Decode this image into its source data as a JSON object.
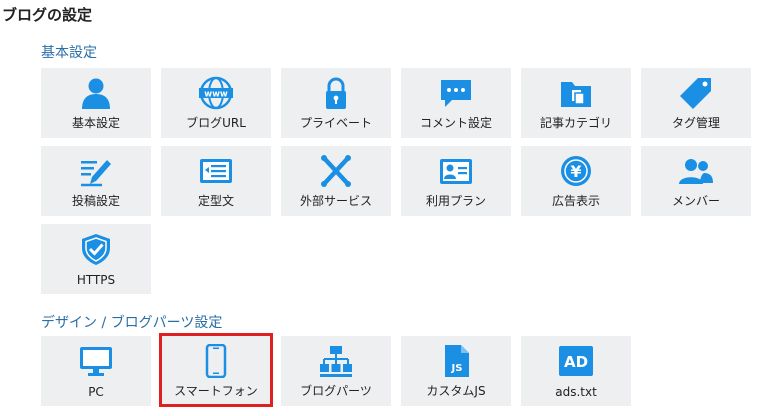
{
  "page_title": "ブログの設定",
  "sections": [
    {
      "title": "基本設定",
      "items": [
        {
          "label": "基本設定",
          "icon": "user-icon"
        },
        {
          "label": "ブログURL",
          "icon": "www-globe-icon"
        },
        {
          "label": "プライベート",
          "icon": "lock-icon"
        },
        {
          "label": "コメント設定",
          "icon": "comment-icon"
        },
        {
          "label": "記事カテゴリ",
          "icon": "folder-icon"
        },
        {
          "label": "タグ管理",
          "icon": "tag-icon"
        },
        {
          "label": "投稿設定",
          "icon": "pencil-icon"
        },
        {
          "label": "定型文",
          "icon": "template-icon"
        },
        {
          "label": "外部サービス",
          "icon": "external-service-icon"
        },
        {
          "label": "利用プラン",
          "icon": "plan-card-icon"
        },
        {
          "label": "広告表示",
          "icon": "yen-coin-icon"
        },
        {
          "label": "メンバー",
          "icon": "members-icon"
        },
        {
          "label": "HTTPS",
          "icon": "shield-check-icon"
        }
      ]
    },
    {
      "title": "デザイン / ブログパーツ設定",
      "items": [
        {
          "label": "PC",
          "icon": "monitor-icon"
        },
        {
          "label": "スマートフォン",
          "icon": "smartphone-icon"
        },
        {
          "label": "ブログパーツ",
          "icon": "blog-parts-icon"
        },
        {
          "label": "カスタムJS",
          "icon": "js-file-icon"
        },
        {
          "label": "ads.txt",
          "icon": "ad-icon",
          "icon_text": "AD"
        }
      ]
    }
  ],
  "colors": {
    "icon": "#1a8fe3",
    "tile_bg": "#eeeff1",
    "section_title": "#2a6ea6",
    "highlight": "#e02020"
  },
  "selected_item": "スマートフォン"
}
